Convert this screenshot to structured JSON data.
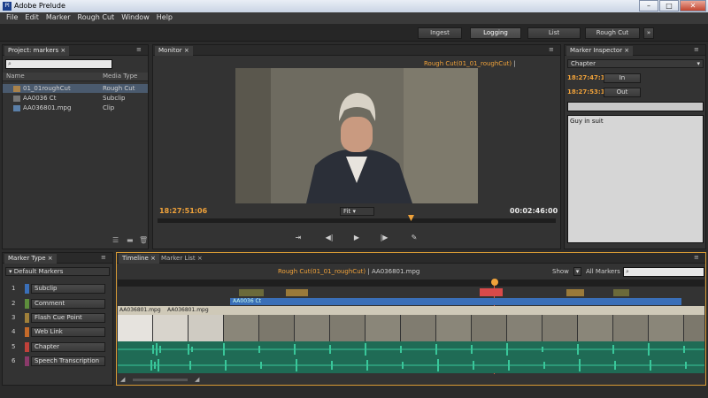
{
  "window": {
    "title": "Adobe Prelude"
  },
  "menu": [
    "File",
    "Edit",
    "Marker",
    "Rough Cut",
    "Window",
    "Help"
  ],
  "workspaces": [
    {
      "label": "Ingest"
    },
    {
      "label": "Logging"
    },
    {
      "label": "List"
    },
    {
      "label": "Rough Cut"
    }
  ],
  "project_panel": {
    "tab": "Project: markers",
    "columns": {
      "name": "Name",
      "media_type": "Media Type"
    },
    "items": [
      {
        "name": "01_01roughCut",
        "type": "Rough Cut"
      },
      {
        "name": "AA0036 Ct",
        "type": "Subclip"
      },
      {
        "name": "AA036801.mpg",
        "type": "Clip"
      }
    ]
  },
  "monitor": {
    "tab": "Monitor",
    "header_rough": "Rough Cut(01_01_roughCut)",
    "header_file": "| AA036801.mpg",
    "timecode_left": "18:27:51:06",
    "timecode_right": "00:02:46:00",
    "zoom": "Fit"
  },
  "inspector": {
    "tab": "Marker Inspector",
    "type_value": "Chapter",
    "in_time": "18:27:47:15",
    "out_time": "18:27:53:10",
    "in_label": "In",
    "out_label": "Out",
    "comment": "Guy in suit"
  },
  "marker_type_panel": {
    "tabs": [
      "Marker Type",
      "Timeline",
      "Marker List"
    ],
    "preset": "Default Markers",
    "items": [
      {
        "num": "1",
        "label": "Subclip",
        "color": "#3a6fb8"
      },
      {
        "num": "2",
        "label": "Comment",
        "color": "#5d8d3c"
      },
      {
        "num": "3",
        "label": "Flash Cue Point",
        "color": "#a0803a"
      },
      {
        "num": "4",
        "label": "Web Link",
        "color": "#c46a2a"
      },
      {
        "num": "5",
        "label": "Chapter",
        "color": "#c0413a"
      },
      {
        "num": "6",
        "label": "Speech Transcription",
        "color": "#8a3a6a"
      }
    ]
  },
  "timeline": {
    "header_rough": "Rough Cut(01_01_roughCut)",
    "header_file": "| AA036801.mpg",
    "show_label": "Show",
    "all_markers": "All Markers",
    "clip_labels": [
      "AA036801.mpg",
      "AA036801.mpg"
    ],
    "subclip_label": "AA0036 Ct"
  },
  "colors": {
    "accent_orange": "#f0a23a",
    "audio_green": "#1f6b55",
    "waveform": "#39c79a"
  }
}
